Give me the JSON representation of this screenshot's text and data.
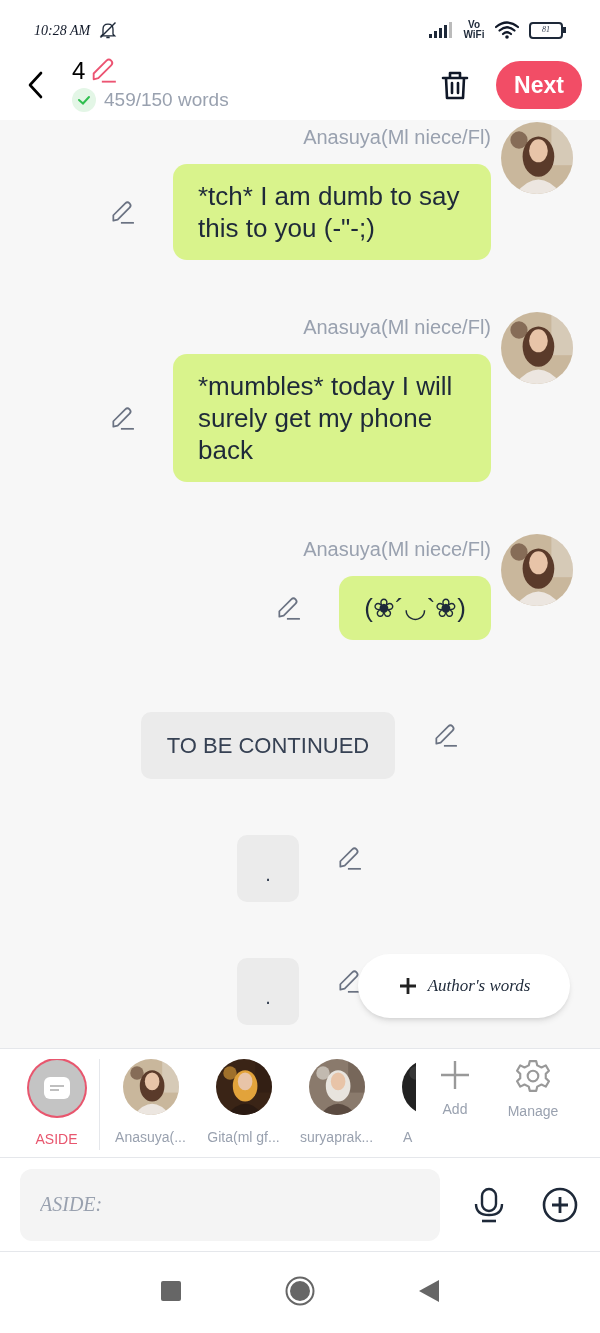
{
  "status_bar": {
    "time": "10:28 AM",
    "network_label": "Vo WiFi",
    "battery": "81"
  },
  "header": {
    "chapter": "4",
    "word_count": "459/150 words",
    "goal_met": true,
    "next_button": "Next"
  },
  "messages": [
    {
      "kind": "message",
      "speaker": "Anasuya(Ml niece/Fl)",
      "text": "*tch* I am dumb to say this to you (-\"-;)"
    },
    {
      "kind": "message",
      "speaker": "Anasuya(Ml niece/Fl)",
      "text": "*mumbles* today I will surely get my phone back"
    },
    {
      "kind": "message",
      "speaker": "Anasuya(Ml niece/Fl)",
      "text": "(❀´◡`❀)"
    },
    {
      "kind": "narration",
      "text": "TO BE CONTINUED"
    },
    {
      "kind": "dot",
      "text": "."
    },
    {
      "kind": "dot",
      "text": "."
    }
  ],
  "author_words_button": "Author's words",
  "characters": [
    {
      "kind": "aside",
      "name": "ASIDE",
      "selected": true
    },
    {
      "kind": "picture",
      "name": "Anasuya(...",
      "selected": false
    },
    {
      "kind": "picture",
      "name": "Gita(ml gf...",
      "selected": false
    },
    {
      "kind": "picture",
      "name": "suryaprak...",
      "selected": false
    },
    {
      "kind": "picture",
      "name": "A",
      "selected": false
    }
  ],
  "character_actions": [
    {
      "kind": "add",
      "label": "Add"
    },
    {
      "kind": "manage",
      "label": "Manage"
    }
  ],
  "input": {
    "placeholder": "ASIDE:"
  }
}
